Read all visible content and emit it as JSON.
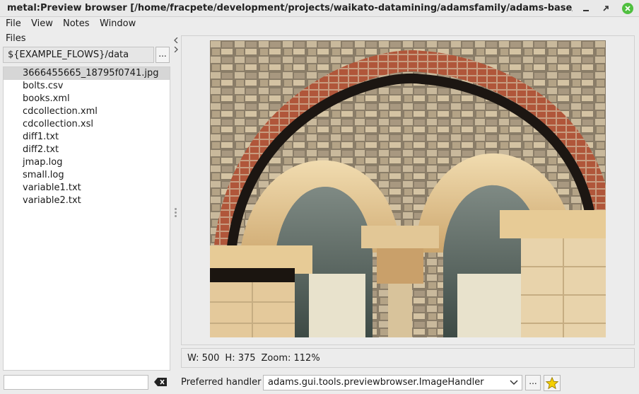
{
  "window": {
    "title": "metal:Preview browser [/home/fracpete/development/projects/waikato-datamining/adamsfamily/adams-base/adams-core...",
    "minimize_icon": "minimize-icon",
    "maximize_icon": "maximize-icon",
    "close_icon": "close-icon",
    "close_color": "#4fbf3f"
  },
  "menubar": {
    "items": [
      "File",
      "View",
      "Notes",
      "Window"
    ]
  },
  "files_panel": {
    "label": "Files",
    "directory": "${EXAMPLE_FLOWS}/data",
    "browse_label": "...",
    "files": [
      "3666455665_18795f0741.jpg",
      "bolts.csv",
      "books.xml",
      "cdcollection.xml",
      "cdcollection.xsl",
      "diff1.txt",
      "diff2.txt",
      "jmap.log",
      "small.log",
      "variable1.txt",
      "variable2.txt"
    ],
    "selected_index": 0,
    "filter_value": "",
    "clear_icon": "clear-filter-icon"
  },
  "preview": {
    "image_subject": "photo of stone double-arched window",
    "status": {
      "width": "W: 500",
      "height": "H: 375",
      "zoom": "Zoom: 112%"
    }
  },
  "handler": {
    "label": "Preferred handler",
    "selected": "adams.gui.tools.previewbrowser.ImageHandler",
    "browse_label": "...",
    "favorite_icon": "star-icon",
    "favorite_color": "#f5d000"
  }
}
